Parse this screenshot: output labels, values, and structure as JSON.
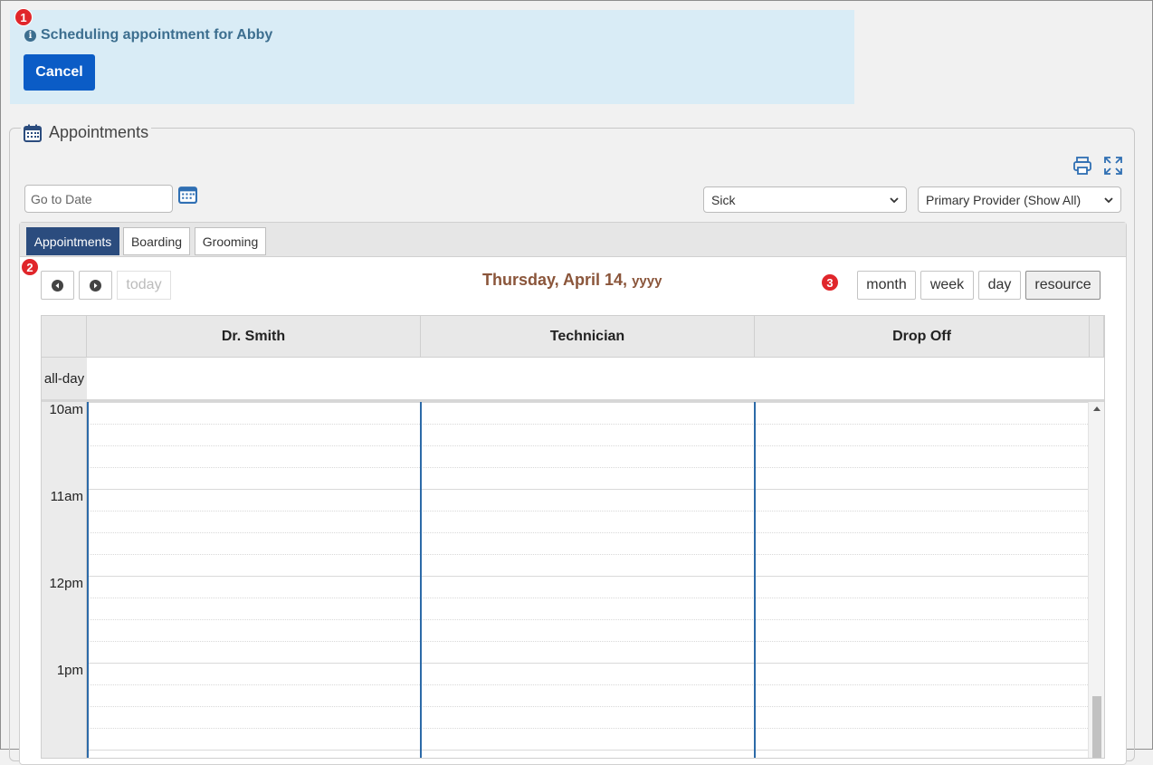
{
  "banner": {
    "badge": "1",
    "message": "Scheduling appointment for Abby",
    "cancel_label": "Cancel"
  },
  "appointments": {
    "title": "Appointments",
    "goto_placeholder": "Go to Date",
    "filter_select": "Sick",
    "provider_select": "Primary Provider (Show All)"
  },
  "tabs": [
    {
      "label": "Appointments",
      "active": true
    },
    {
      "label": "Boarding",
      "active": false
    },
    {
      "label": "Grooming",
      "active": false
    }
  ],
  "toolbar": {
    "badge2": "2",
    "badge3": "3",
    "today_label": "today",
    "date_title": "Thursday, April 14,",
    "date_year": "yyyy",
    "views": [
      "month",
      "week",
      "day",
      "resource"
    ],
    "active_view": "resource"
  },
  "calendar": {
    "resources": [
      "Dr. Smith",
      "Technician",
      "Drop Off"
    ],
    "allday_label": "all-day",
    "time_labels": [
      "10am",
      "11am",
      "12pm",
      "1pm"
    ]
  },
  "colors": {
    "accent": "#0b5cc6",
    "tab_active": "#2b4c7e",
    "date_title": "#8a553a",
    "badge": "#e0262b"
  }
}
